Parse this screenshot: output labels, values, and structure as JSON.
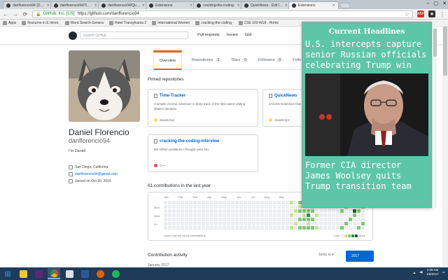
{
  "browser": {
    "tabs": [
      {
        "label": "danflorencio94 (Daniel F",
        "active": false
      },
      {
        "label": "danflorencio94/Time-Tr",
        "active": false
      },
      {
        "label": "danflorencio94/QuickN",
        "active": false
      },
      {
        "label": "Extensions",
        "active": false
      },
      {
        "label": "cracking-the-coding-",
        "active": false
      },
      {
        "label": "QuickNews - Edit Item",
        "active": false
      },
      {
        "label": "Extensions",
        "active": true
      }
    ],
    "address": {
      "secure_label": "GitHub, Inc. [US]",
      "url": "https://github.com/danflorencio94"
    },
    "bookmarks": [
      "Apps",
      "Nocturne in E minor,",
      "Word Search Genera",
      "Hotel Transylvania 2",
      "International Women",
      "cracking-the-coding-",
      "CSE 160 W18 - Home"
    ],
    "extensions": [
      {
        "icon": "abp-icon",
        "label": "ABP"
      },
      {
        "icon": "quicknews-icon",
        "label": ""
      }
    ]
  },
  "github": {
    "search_placeholder": "Search GitHub",
    "nav": [
      "Pull requests",
      "Issues",
      "Gist"
    ],
    "profile": {
      "full_name": "Daniel Florencio",
      "login": "danflorencio94",
      "bio": "I'm Daniel",
      "location": "San Diego, California",
      "email": "danflorencio94@gmail.com",
      "joined": "Joined on Oct 30, 2015"
    },
    "tabs": [
      {
        "label": "Overview",
        "count": null,
        "active": true
      },
      {
        "label": "Repositories",
        "count": "3",
        "active": false
      },
      {
        "label": "Stars",
        "count": "0",
        "active": false
      },
      {
        "label": "Followers",
        "count": "0",
        "active": false
      },
      {
        "label": "Follo",
        "count": null,
        "active": false
      }
    ],
    "pinned_title": "Pinned repositories",
    "pinned": [
      {
        "name": "Time-Tracker",
        "desc": "A simple chrome extension to keep track of the time spent visiting distinct domains",
        "lang": "JavaScript",
        "lang_color": "#f1e05a"
      },
      {
        "name": "QuickNews",
        "desc": "Chrome Extension that",
        "lang": "JavaScript",
        "lang_color": "#f1e05a"
      },
      {
        "name": "cracking-the-coding-interview",
        "desc": "6th edition problems I thought were fun",
        "lang": "C++",
        "lang_color": "#e34c5b"
      }
    ],
    "contrib_title": "61 contributions in the last year",
    "months": [
      "Jan",
      "Feb",
      "Mar",
      "Apr",
      "May",
      "Jun",
      "Jul",
      "Aug",
      "Sep"
    ],
    "day_labels": [
      "Mon",
      "Wed",
      "Fri"
    ],
    "contrib_footer": "Learn how we count contributions.",
    "legend_less": "Less",
    "legend_more": "More",
    "legend_colors": [
      "#ebedf0",
      "#c6e48b",
      "#7bc96f",
      "#239a3b",
      "#196127"
    ],
    "activity_title": "Contribution activity",
    "jump_to": "Jump to ▾",
    "year": "2017",
    "month_label": "January 2017"
  },
  "popup": {
    "heading": "Current Headlines",
    "headline1": "U.S. intercepts capture senior Russian officials celebrating Trump win",
    "headline2": "Former CIA director James Woolsey quits Trump transition team"
  },
  "taskbar": {
    "apps": [
      "file-explorer-icon",
      "visual-studio-icon",
      "chrome-icon",
      "photos-icon",
      "word-icon",
      "firefox-icon",
      "spotify-icon"
    ],
    "time": "1:08 AM",
    "date": "1/6/2017"
  }
}
